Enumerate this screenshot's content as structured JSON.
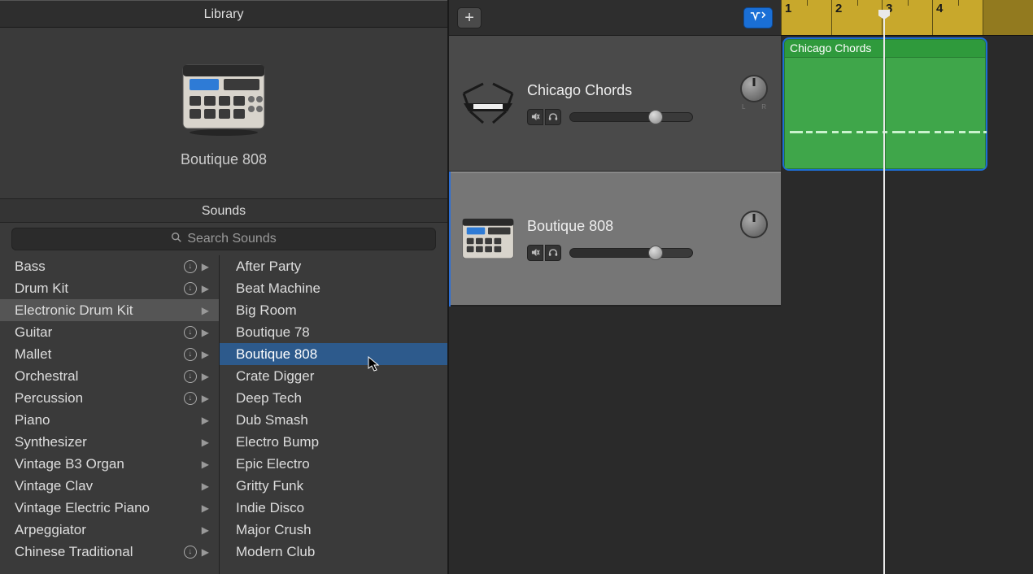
{
  "library": {
    "title": "Library",
    "preview_name": "Boutique 808",
    "sounds_header": "Sounds",
    "search_placeholder": "Search Sounds",
    "categories": [
      {
        "label": "Bass",
        "download": true,
        "expand": true,
        "selected": false
      },
      {
        "label": "Drum Kit",
        "download": true,
        "expand": true,
        "selected": false
      },
      {
        "label": "Electronic Drum Kit",
        "download": false,
        "expand": true,
        "selected": true
      },
      {
        "label": "Guitar",
        "download": true,
        "expand": true,
        "selected": false
      },
      {
        "label": "Mallet",
        "download": true,
        "expand": true,
        "selected": false
      },
      {
        "label": "Orchestral",
        "download": true,
        "expand": true,
        "selected": false
      },
      {
        "label": "Percussion",
        "download": true,
        "expand": true,
        "selected": false
      },
      {
        "label": "Piano",
        "download": false,
        "expand": true,
        "selected": false
      },
      {
        "label": "Synthesizer",
        "download": false,
        "expand": true,
        "selected": false
      },
      {
        "label": "Vintage B3 Organ",
        "download": false,
        "expand": true,
        "selected": false
      },
      {
        "label": "Vintage Clav",
        "download": false,
        "expand": true,
        "selected": false
      },
      {
        "label": "Vintage Electric Piano",
        "download": false,
        "expand": true,
        "selected": false
      },
      {
        "label": "Arpeggiator",
        "download": false,
        "expand": true,
        "selected": false
      },
      {
        "label": "Chinese Traditional",
        "download": true,
        "expand": true,
        "selected": false
      }
    ],
    "sounds": [
      "After Party",
      "Beat Machine",
      "Big Room",
      "Boutique 78",
      "Boutique 808",
      "Crate Digger",
      "Deep Tech",
      "Dub Smash",
      "Electro Bump",
      "Epic Electro",
      "Gritty Funk",
      "Indie Disco",
      "Major Crush",
      "Modern Club"
    ],
    "selected_sound": "Boutique 808"
  },
  "tracks": {
    "lr": [
      "L",
      "R"
    ],
    "list": [
      {
        "name": "Chicago Chords",
        "selected": false,
        "volume_pct": 70,
        "thumb": "keyboard"
      },
      {
        "name": "Boutique 808",
        "selected": true,
        "volume_pct": 70,
        "thumb": "drum-machine"
      }
    ]
  },
  "timeline": {
    "bars": [
      "1",
      "2",
      "3",
      "4"
    ],
    "active_bars": 4,
    "playhead_bar": 3,
    "region": {
      "label": "Chicago Chords",
      "start_bar": 1,
      "length_bars": 4,
      "track_index": 0
    }
  }
}
